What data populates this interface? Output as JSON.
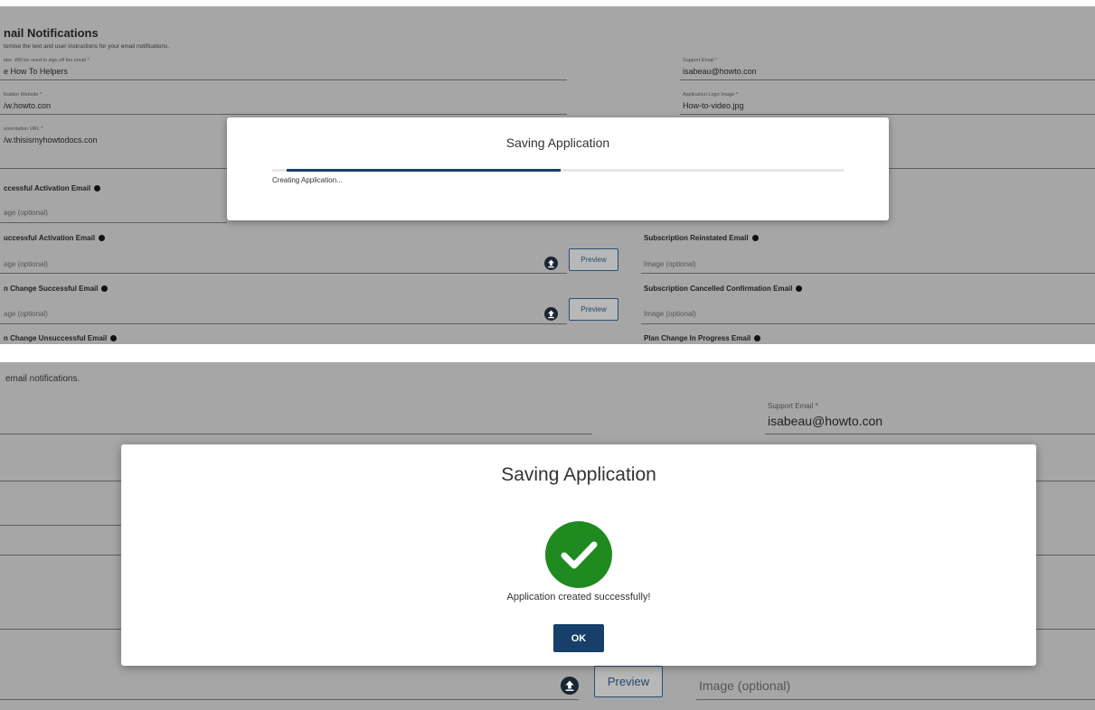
{
  "top": {
    "heading": "nail Notifications",
    "subheading": "tomise the text and user instructions for your email notifications.",
    "fields": {
      "sender_label": "ider. Will be used to sign off the email *",
      "sender_value": "e How To Helpers",
      "support_email_label": "Support Email *",
      "support_email_value": "isabeau@howto.con",
      "website_label": "lication Website *",
      "website_value": "/w.howto.con",
      "logo_label": "Application Logo Image *",
      "logo_value": "How-to-video.jpg",
      "doc_url_label": "umentation URL *",
      "doc_url_value": "/w.thisismyhowtodocs.con"
    },
    "emails": {
      "successful_activation": "ccessful Activation Email",
      "successful_activation_ph": "age (optional)",
      "unsuccessful_activation": "uccessful Activation Email",
      "unsuccessful_activation_ph": "age (optional)",
      "subscription_reinstated": "Subscription Reinstated Email",
      "subscription_reinstated_ph": "Image (optional)",
      "plan_change_success": "n Change Successful Email",
      "plan_change_success_ph": "age (optional)",
      "subscription_cancelled": "Subscription Cancelled Confirmation Email",
      "subscription_cancelled_ph": "Image (optional)",
      "plan_change_unsuccess": "n Change Unsuccessful Email",
      "plan_change_progress": "Plan Change In Progress Email"
    },
    "preview_label": "Preview",
    "dialog": {
      "title": "Saving Application",
      "status": "Creating Application...",
      "progress_percent": 48
    }
  },
  "bottom": {
    "subheading": "email notifications.",
    "support_email_label": "Support Email *",
    "support_email_value": "isabeau@howto.con",
    "preview_label": "Preview",
    "image_placeholder": "Image (optional)",
    "dialog": {
      "title": "Saving Application",
      "message": "Application created successfully!",
      "ok_label": "OK"
    }
  },
  "colors": {
    "overlay": "#a6a6a6",
    "primary": "#163f6b",
    "success": "#1f8a1f"
  }
}
